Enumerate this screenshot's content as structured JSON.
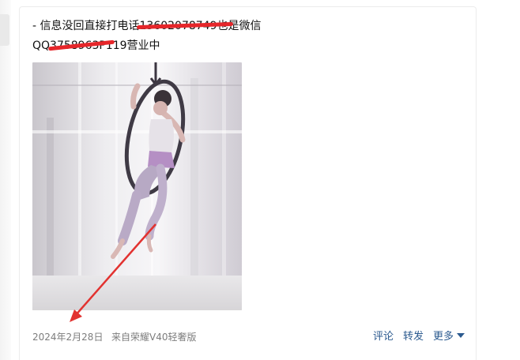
{
  "post": {
    "line1": "-   信息没回直接打电话13602078749也是微信",
    "line2": "QQ3758963P119营业中",
    "date": "2024年2月28日",
    "source": "来自荣耀V40轻奢版",
    "actions": {
      "comment": "评论",
      "forward": "转发",
      "more": "更多"
    }
  },
  "colors": {
    "redaction": "#e6262a",
    "link": "#2b5a8f",
    "meta": "#7d7d7d"
  },
  "image": {
    "content": "aerial hoop performer in front of sheer curtains"
  }
}
